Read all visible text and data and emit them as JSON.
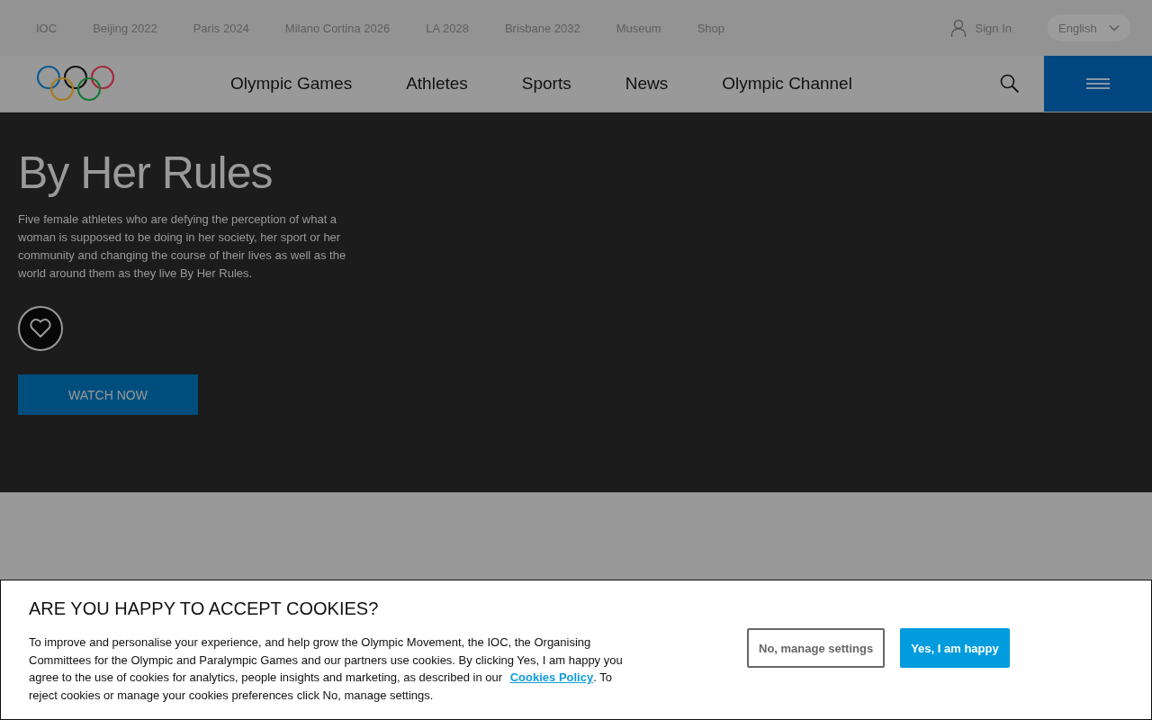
{
  "top_links": [
    "IOC",
    "Beijing 2022",
    "Paris 2024",
    "Milano Cortina 2026",
    "LA 2028",
    "Brisbane 2032",
    "Museum",
    "Shop"
  ],
  "sign_in": "Sign In",
  "language": "English",
  "nav": [
    "Olympic Games",
    "Athletes",
    "Sports",
    "News",
    "Olympic Channel"
  ],
  "hero": {
    "title": "By Her Rules",
    "description": "Five female athletes who are defying the perception of what a woman is supposed to be doing in her society, her sport or her community and changing the course of their lives as well as the world around them as they live By Her Rules.",
    "favorited": false,
    "button": "WATCH NOW"
  },
  "cookie_banner": {
    "title": "ARE YOU HAPPY TO ACCEPT COOKIES?",
    "text_before": "To improve and personalise your experience, and help grow the Olympic Movement, the IOC, the Organising Committees for the Olympic and Paralympic Games and our partners use cookies. By clicking Yes, I am happy you agree to the use of cookies for analytics, people insights and marketing, as described in our ",
    "link": "Cookies Policy",
    "text_after": ". To reject cookies or manage your cookies preferences click No, manage settings.",
    "decline_button": "No, manage settings",
    "accept_button": "Yes, I am happy"
  }
}
